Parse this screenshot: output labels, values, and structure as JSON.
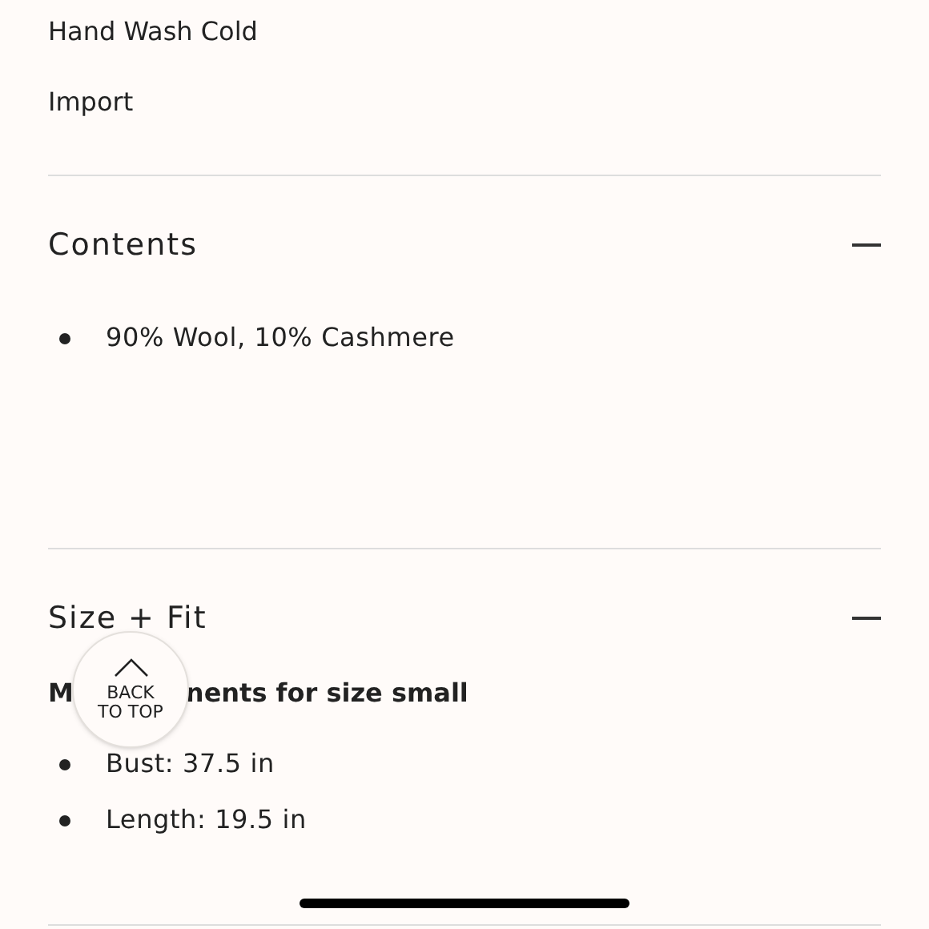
{
  "care_lines": [
    "Hand Wash Cold",
    "Import"
  ],
  "sections": [
    {
      "title": "Contents",
      "expanded": true,
      "bullets": [
        "90% Wool, 10% Cashmere"
      ]
    },
    {
      "title": "Size + Fit",
      "expanded": true,
      "heading_parts": [
        "M",
        "nents for size small"
      ],
      "bullets": [
        "Bust: 37.5 in",
        "Length: 19.5 in"
      ]
    }
  ],
  "back_to_top": [
    "BACK",
    "TO TOP"
  ]
}
